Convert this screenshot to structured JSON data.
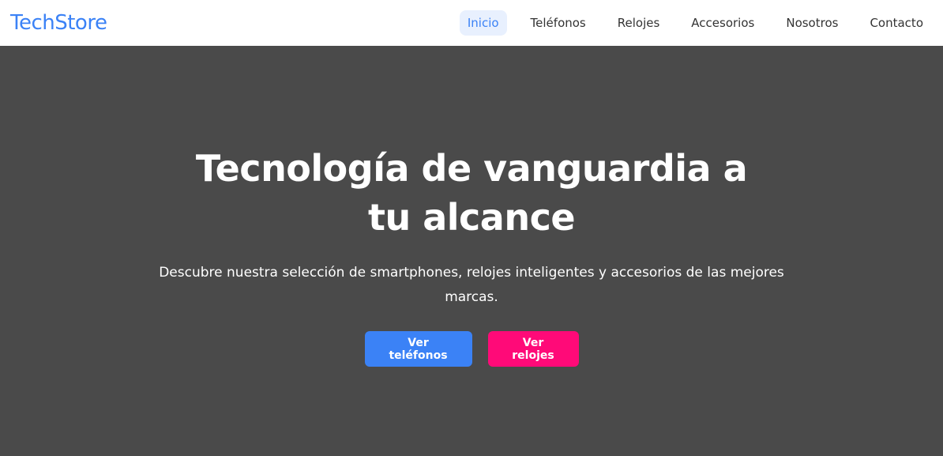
{
  "brand": {
    "name": "TechStore",
    "color": "#3b82f6"
  },
  "nav": {
    "active_index": 0,
    "items": [
      {
        "label": "Inicio"
      },
      {
        "label": "Teléfonos"
      },
      {
        "label": "Relojes"
      },
      {
        "label": "Accesorios"
      },
      {
        "label": "Nosotros"
      },
      {
        "label": "Contacto"
      }
    ]
  },
  "hero": {
    "title": "Tecnología de vanguardia a tu alcance",
    "subtitle": "Descubre nuestra selección de smartphones, relojes inteligentes y accesorios de las mejores marcas.",
    "background_color": "#4a4a4a",
    "buttons": {
      "primary": {
        "label": "Ver teléfonos",
        "color": "#3b82f6"
      },
      "secondary": {
        "label": "Ver relojes",
        "color": "#ff0a78"
      }
    }
  }
}
